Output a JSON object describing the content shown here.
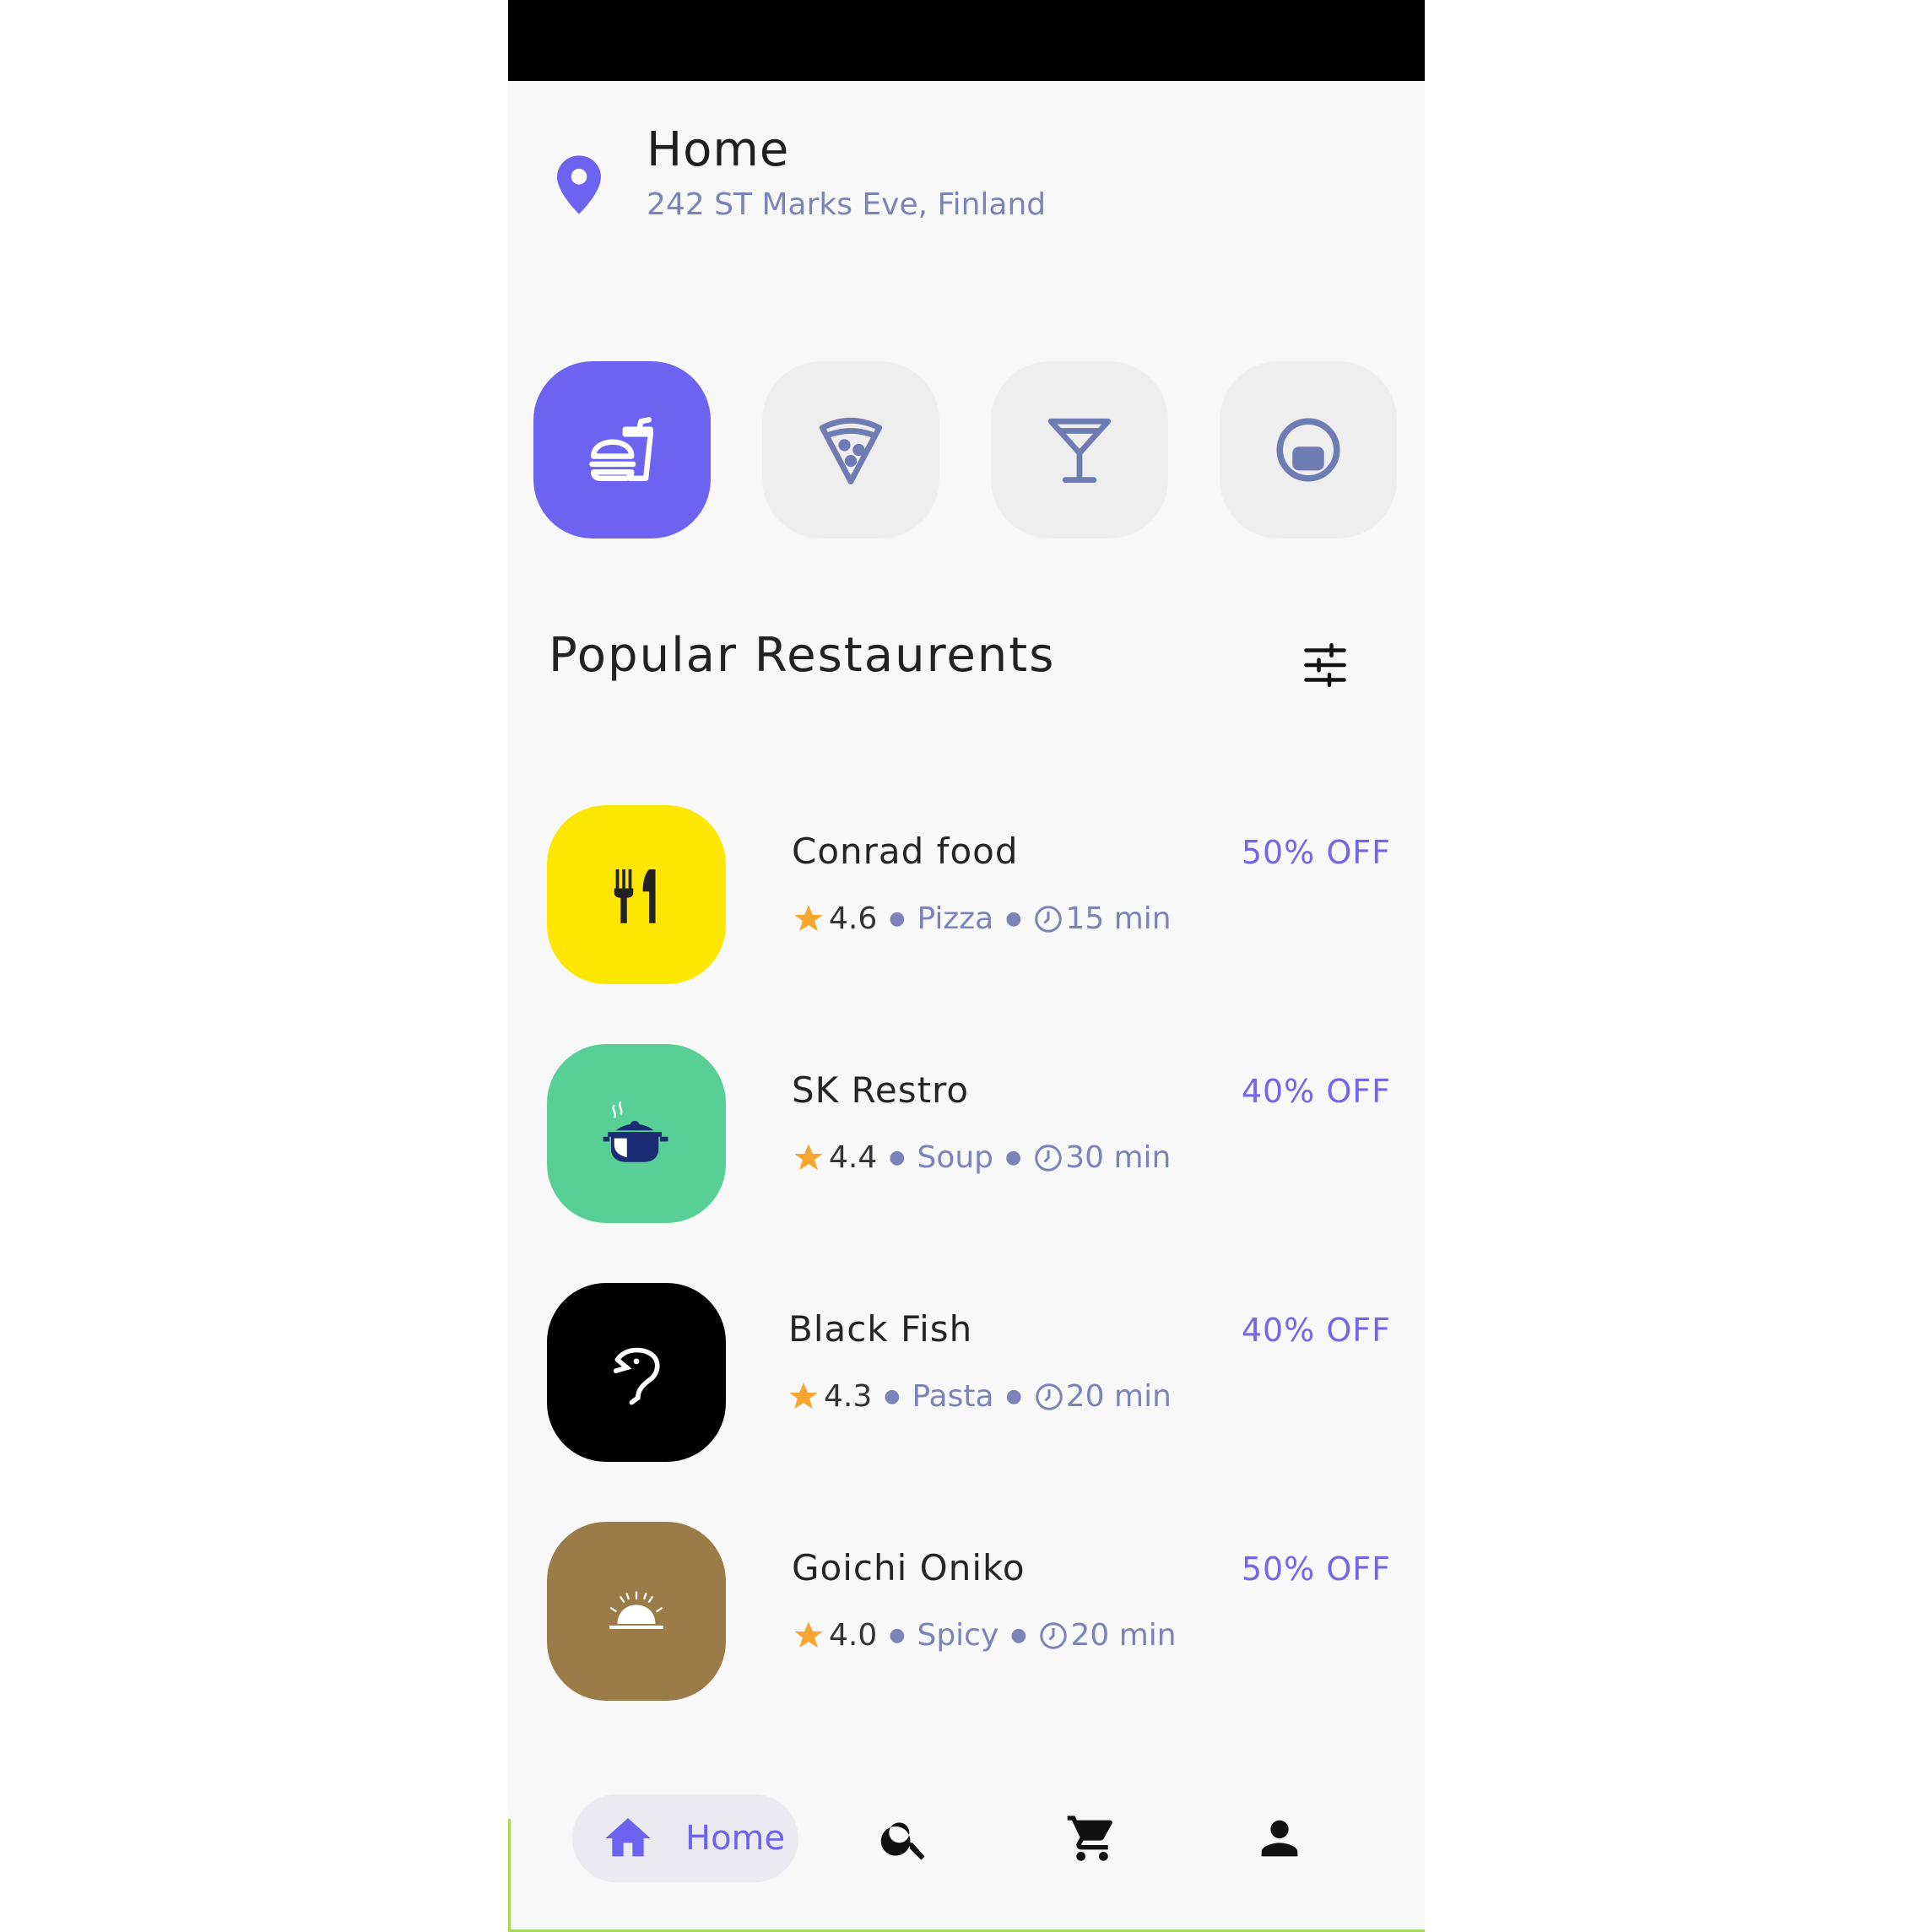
{
  "location": {
    "title": "Home",
    "address": "242 ST Marks Eve, Finland",
    "icon": "location-pin-icon"
  },
  "categories": [
    {
      "name": "fast-food",
      "icon": "burger-drink-icon",
      "active": true
    },
    {
      "name": "pizza",
      "icon": "pizza-slice-icon",
      "active": false
    },
    {
      "name": "drinks",
      "icon": "cocktail-icon",
      "active": false
    },
    {
      "name": "dessert",
      "icon": "round-dish-icon",
      "active": false
    }
  ],
  "section": {
    "title": "Popular Restaurents",
    "filter_icon": "sliders-icon"
  },
  "restaurants": [
    {
      "name": "Conrad food",
      "rating": "4.6",
      "cuisine": "Pizza",
      "time": "15 min",
      "discount": "50% OFF",
      "color": "#fde700",
      "icon": "fork-knife-icon"
    },
    {
      "name": "SK Restro",
      "rating": "4.4",
      "cuisine": "Soup",
      "time": "30 min",
      "discount": "40% OFF",
      "color": "#58cf95",
      "icon": "cooking-pot-icon"
    },
    {
      "name": "Black Fish",
      "rating": "4.3",
      "cuisine": "Pasta",
      "time": "20 min",
      "discount": "40% OFF",
      "color": "#000000",
      "icon": "fish-icon"
    },
    {
      "name": "Goichi Oniko",
      "rating": "4.0",
      "cuisine": "Spicy",
      "time": "20 min",
      "discount": "50% OFF",
      "color": "#9b7c49",
      "icon": "serving-cloche-icon"
    }
  ],
  "nav": {
    "home_label": "Home",
    "items": [
      "home-icon",
      "search-icon",
      "cart-icon",
      "profile-icon"
    ]
  },
  "colors": {
    "accent": "#6c63f0",
    "muted": "#7b83b8",
    "star": "#f6a531"
  }
}
